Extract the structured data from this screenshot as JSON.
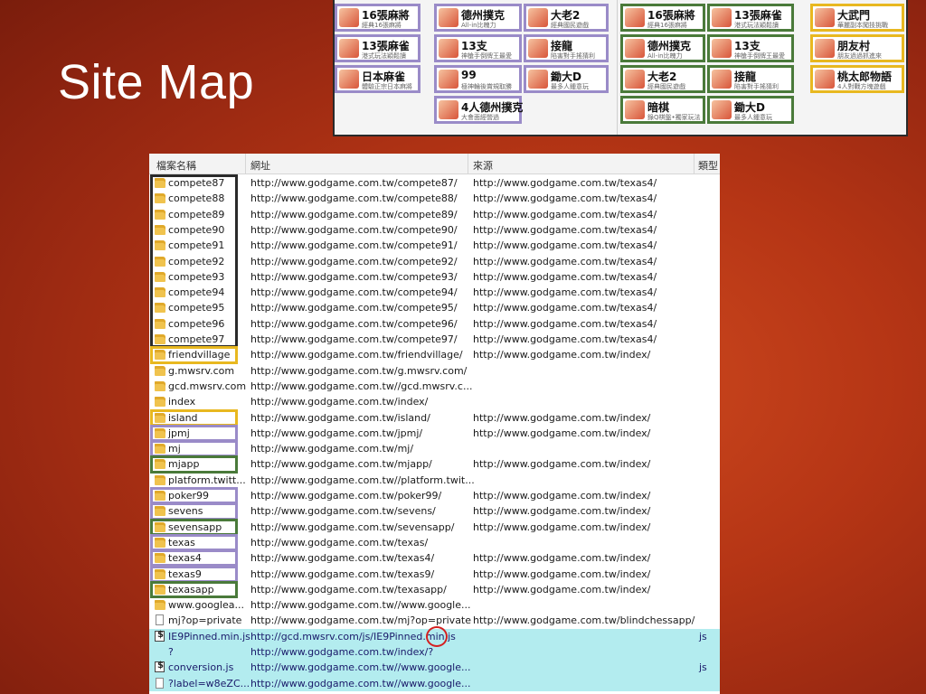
{
  "slide": {
    "title": "Site Map"
  },
  "games_left": [
    {
      "title": "16張麻將",
      "subtitle": "經典16張麻將",
      "border": "purple"
    },
    {
      "title": "德州撲克",
      "subtitle": "All-in比魄力",
      "border": "purple"
    },
    {
      "title": "大老2",
      "subtitle": "經典國民遊戲",
      "border": "purple"
    },
    {
      "title": "13張麻雀",
      "subtitle": "港式玩法穎鬆讀",
      "border": "purple"
    },
    {
      "title": "13支",
      "subtitle": "神槍手倒牌王最愛",
      "border": "purple"
    },
    {
      "title": "接龍",
      "subtitle": "陷害對手搖猜利",
      "border": "purple"
    },
    {
      "title": "日本麻雀",
      "subtitle": "體驗正宗日本麻將",
      "border": "purple"
    },
    {
      "title": "99",
      "subtitle": "極神輪後賞規取勝",
      "border": "purple"
    },
    {
      "title": "鋤大D",
      "subtitle": "最多人鍾意玩",
      "border": "purple"
    },
    {
      "title": "4人德州撲克",
      "subtitle": "大會面經營過",
      "border": "purple"
    }
  ],
  "games_right": [
    {
      "title": "16張麻將",
      "subtitle": "經典16張麻將",
      "border": "green"
    },
    {
      "title": "13張麻雀",
      "subtitle": "港式玩法穎鬆讀",
      "border": "green"
    },
    {
      "title": "大武門",
      "subtitle": "華麗副本闖技挑戰",
      "border": "gold"
    },
    {
      "title": "德州撲克",
      "subtitle": "All-in比魄力",
      "border": "green"
    },
    {
      "title": "13支",
      "subtitle": "神槍手倒牌王最愛",
      "border": "green"
    },
    {
      "title": "朋友村",
      "subtitle": "朋友過過抓進來",
      "border": "gold"
    },
    {
      "title": "大老2",
      "subtitle": "經典國民遊戲",
      "border": "green"
    },
    {
      "title": "接龍",
      "subtitle": "陷害對手搖猜利",
      "border": "green"
    },
    {
      "title": "桃太郎物語",
      "subtitle": "4人對戰方塊遊戲",
      "border": "gold"
    },
    {
      "title": "暗棋",
      "subtitle": "錄Q棋盤•獨家玩法",
      "border": "green"
    },
    {
      "title": "鋤大D",
      "subtitle": "最多人鍾意玩",
      "border": "green"
    }
  ],
  "file_list": {
    "columns": {
      "name": "檔案名稱",
      "url": "網址",
      "source": "來源",
      "type": "類型"
    },
    "rows": [
      {
        "name": "compete87",
        "url": "http://www.godgame.com.tw/compete87/",
        "source": "http://www.godgame.com.tw/texas4/",
        "type": "",
        "icon": "folder-icon"
      },
      {
        "name": "compete88",
        "url": "http://www.godgame.com.tw/compete88/",
        "source": "http://www.godgame.com.tw/texas4/",
        "type": "",
        "icon": "folder-icon"
      },
      {
        "name": "compete89",
        "url": "http://www.godgame.com.tw/compete89/",
        "source": "http://www.godgame.com.tw/texas4/",
        "type": "",
        "icon": "folder-icon"
      },
      {
        "name": "compete90",
        "url": "http://www.godgame.com.tw/compete90/",
        "source": "http://www.godgame.com.tw/texas4/",
        "type": "",
        "icon": "folder-icon"
      },
      {
        "name": "compete91",
        "url": "http://www.godgame.com.tw/compete91/",
        "source": "http://www.godgame.com.tw/texas4/",
        "type": "",
        "icon": "folder-icon"
      },
      {
        "name": "compete92",
        "url": "http://www.godgame.com.tw/compete92/",
        "source": "http://www.godgame.com.tw/texas4/",
        "type": "",
        "icon": "folder-icon"
      },
      {
        "name": "compete93",
        "url": "http://www.godgame.com.tw/compete93/",
        "source": "http://www.godgame.com.tw/texas4/",
        "type": "",
        "icon": "folder-icon"
      },
      {
        "name": "compete94",
        "url": "http://www.godgame.com.tw/compete94/",
        "source": "http://www.godgame.com.tw/texas4/",
        "type": "",
        "icon": "folder-icon"
      },
      {
        "name": "compete95",
        "url": "http://www.godgame.com.tw/compete95/",
        "source": "http://www.godgame.com.tw/texas4/",
        "type": "",
        "icon": "folder-icon"
      },
      {
        "name": "compete96",
        "url": "http://www.godgame.com.tw/compete96/",
        "source": "http://www.godgame.com.tw/texas4/",
        "type": "",
        "icon": "folder-icon"
      },
      {
        "name": "compete97",
        "url": "http://www.godgame.com.tw/compete97/",
        "source": "http://www.godgame.com.tw/texas4/",
        "type": "",
        "icon": "folder-icon"
      },
      {
        "name": "friendvillage",
        "url": "http://www.godgame.com.tw/friendvillage/",
        "source": "http://www.godgame.com.tw/index/",
        "type": "",
        "icon": "folder-icon"
      },
      {
        "name": "g.mwsrv.com",
        "url": "http://www.godgame.com.tw/g.mwsrv.com/",
        "source": "",
        "type": "",
        "icon": "folder-icon"
      },
      {
        "name": "gcd.mwsrv.com",
        "url": "http://www.godgame.com.tw//gcd.mwsrv.c...",
        "source": "",
        "type": "",
        "icon": "folder-icon"
      },
      {
        "name": "index",
        "url": "http://www.godgame.com.tw/index/",
        "source": "",
        "type": "",
        "icon": "folder-icon"
      },
      {
        "name": "island",
        "url": "http://www.godgame.com.tw/island/",
        "source": "http://www.godgame.com.tw/index/",
        "type": "",
        "icon": "folder-icon"
      },
      {
        "name": "jpmj",
        "url": "http://www.godgame.com.tw/jpmj/",
        "source": "http://www.godgame.com.tw/index/",
        "type": "",
        "icon": "folder-icon"
      },
      {
        "name": "mj",
        "url": "http://www.godgame.com.tw/mj/",
        "source": "",
        "type": "",
        "icon": "folder-icon"
      },
      {
        "name": "mjapp",
        "url": "http://www.godgame.com.tw/mjapp/",
        "source": "http://www.godgame.com.tw/index/",
        "type": "",
        "icon": "folder-icon"
      },
      {
        "name": "platform.twitt...",
        "url": "http://www.godgame.com.tw//platform.twit...",
        "source": "",
        "type": "",
        "icon": "folder-icon"
      },
      {
        "name": "poker99",
        "url": "http://www.godgame.com.tw/poker99/",
        "source": "http://www.godgame.com.tw/index/",
        "type": "",
        "icon": "folder-icon"
      },
      {
        "name": "sevens",
        "url": "http://www.godgame.com.tw/sevens/",
        "source": "http://www.godgame.com.tw/index/",
        "type": "",
        "icon": "folder-icon"
      },
      {
        "name": "sevensapp",
        "url": "http://www.godgame.com.tw/sevensapp/",
        "source": "http://www.godgame.com.tw/index/",
        "type": "",
        "icon": "folder-icon"
      },
      {
        "name": "texas",
        "url": "http://www.godgame.com.tw/texas/",
        "source": "",
        "type": "",
        "icon": "folder-icon"
      },
      {
        "name": "texas4",
        "url": "http://www.godgame.com.tw/texas4/",
        "source": "http://www.godgame.com.tw/index/",
        "type": "",
        "icon": "folder-icon"
      },
      {
        "name": "texas9",
        "url": "http://www.godgame.com.tw/texas9/",
        "source": "http://www.godgame.com.tw/index/",
        "type": "",
        "icon": "folder-icon"
      },
      {
        "name": "texasapp",
        "url": "http://www.godgame.com.tw/texasapp/",
        "source": "http://www.godgame.com.tw/index/",
        "type": "",
        "icon": "folder-icon"
      },
      {
        "name": "www.googlea...",
        "url": "http://www.godgame.com.tw//www.google...",
        "source": "",
        "type": "",
        "icon": "folder-icon"
      },
      {
        "name": "mj?op=private",
        "url": "http://www.godgame.com.tw/mj?op=private",
        "source": "http://www.godgame.com.tw/blindchessapp/",
        "type": "",
        "icon": "file-icon"
      },
      {
        "name": "IE9Pinned.min.js",
        "url": "http://gcd.mwsrv.com/js/IE9Pinned.min.js",
        "source": "",
        "type": "js",
        "icon": "script-icon",
        "highlighted": true
      },
      {
        "name": "?",
        "url": "http://www.godgame.com.tw/index/?",
        "source": "",
        "type": "",
        "icon": "none",
        "highlighted": true
      },
      {
        "name": "conversion.js",
        "url": "http://www.godgame.com.tw//www.google...",
        "source": "",
        "type": "js",
        "icon": "script-icon",
        "highlighted": true
      },
      {
        "name": "?label=w8eZC...",
        "url": "http://www.godgame.com.tw//www.google...",
        "source": "",
        "type": "",
        "icon": "file-icon",
        "highlighted": true
      }
    ]
  },
  "colors": {
    "background": "#b53515",
    "purple_box": "#9a8bc8",
    "gold_box": "#e8b820",
    "green_box": "#4a7a3a",
    "black_box": "#2a2a2a",
    "highlight_row": "#b3ecef",
    "circle": "#d42020"
  }
}
